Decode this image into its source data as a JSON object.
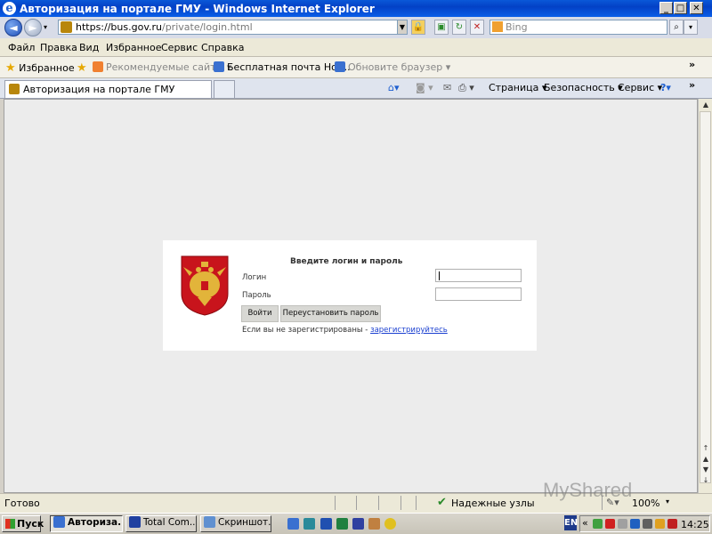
{
  "window": {
    "title": "Авторизация на портале ГМУ - Windows Internet Explorer",
    "min_label": "_",
    "max_label": "□",
    "close_label": "✕"
  },
  "address_bar": {
    "url_host": "https://bus.gov.ru",
    "url_path": "/private/login.html",
    "search_placeholder": "Bing"
  },
  "menu": [
    "Файл",
    "Правка",
    "Вид",
    "Избранное",
    "Сервис",
    "Справка"
  ],
  "favorites_bar": {
    "favorites_label": "Избранное",
    "items": [
      "Рекомендуемые сайты ▾",
      "Бесплатная почта Hot...",
      "Обновите браузер ▾"
    ],
    "overflow": "»"
  },
  "tabs": {
    "active_tab_label": "Авторизация на портале ГМУ"
  },
  "command_bar": [
    "Страница ▾",
    "Безопасность ▾",
    "Сервис ▾"
  ],
  "login": {
    "title": "Введите логин и пароль",
    "login_label": "Логин",
    "password_label": "Пароль",
    "login_value": "",
    "password_value": "",
    "submit_label": "Войти",
    "reset_label": "Переустановить пароль",
    "register_text": "Если вы не зарегистрированы  -",
    "register_link": "зарегистрируйтесь"
  },
  "statusbar": {
    "status": "Готово",
    "zone": "Надежные узлы",
    "zoom": "100%"
  },
  "taskbar": {
    "start_label": "Пуск",
    "tasks": [
      "Авториза...",
      "Total Com...",
      "Скриншот..."
    ],
    "clock": "14:25"
  },
  "watermark": "MyShared"
}
